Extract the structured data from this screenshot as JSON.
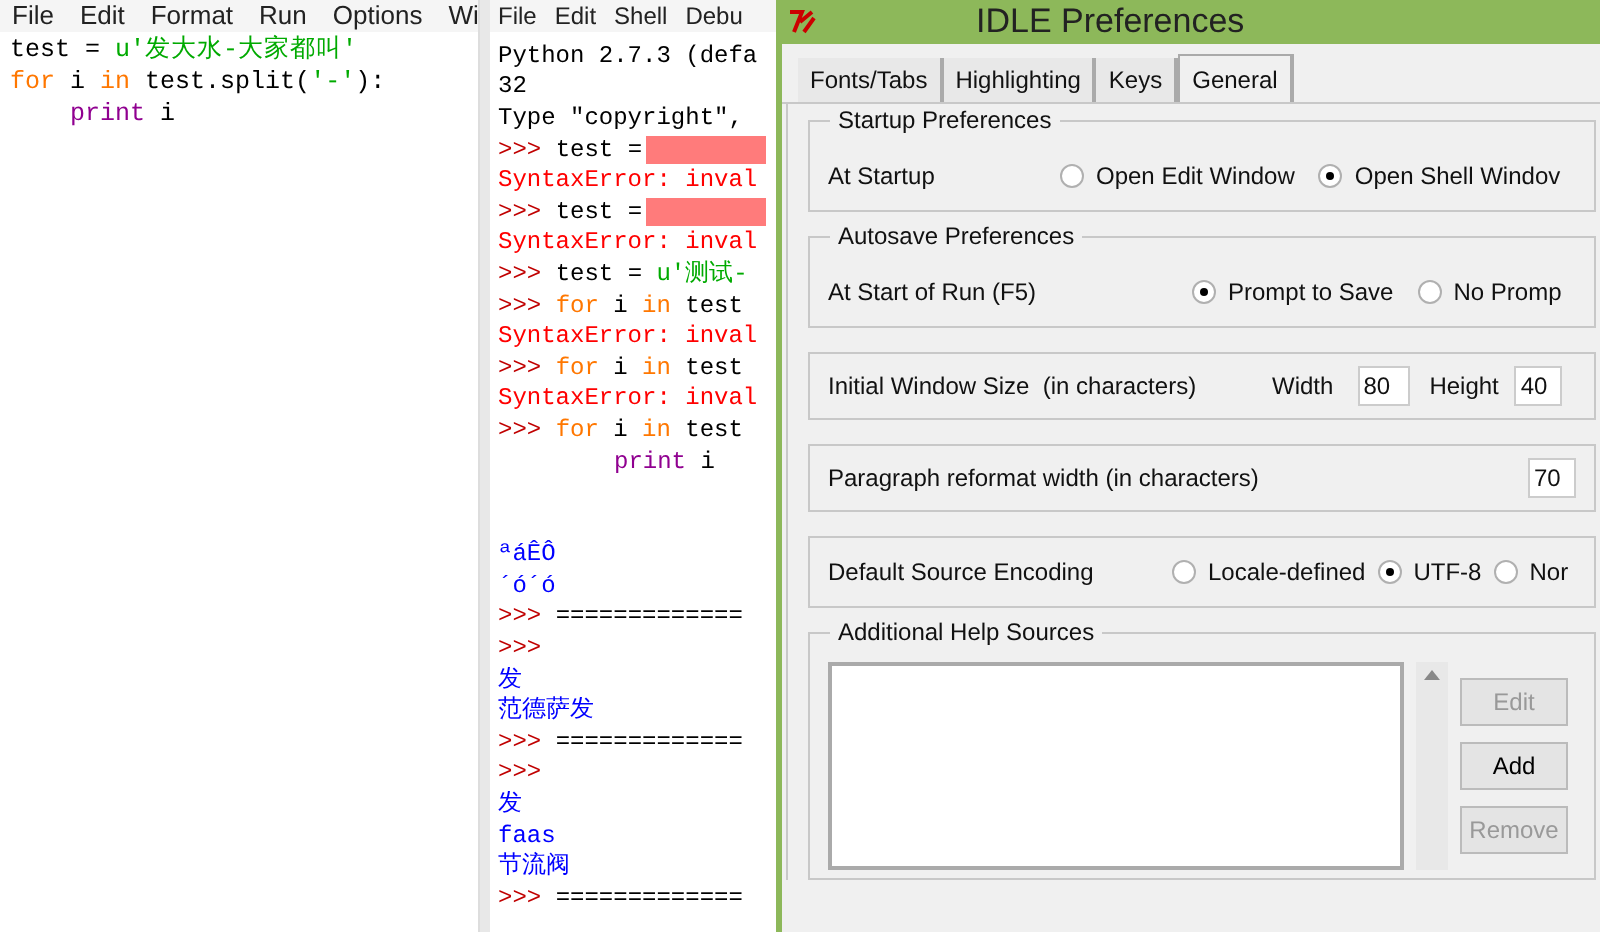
{
  "editor": {
    "menu": [
      "File",
      "Edit",
      "Format",
      "Run",
      "Options",
      "Wi"
    ],
    "lines": [
      {
        "segments": [
          {
            "text": "test = ",
            "kind": "plain"
          },
          {
            "text": "u'发大水-大家都叫'",
            "kind": "string"
          }
        ]
      },
      {
        "segments": [
          {
            "text": "for",
            "kind": "keyword"
          },
          {
            "text": " i ",
            "kind": "plain"
          },
          {
            "text": "in",
            "kind": "keyword"
          },
          {
            "text": " test.split(",
            "kind": "plain"
          },
          {
            "text": "'-'",
            "kind": "string"
          },
          {
            "text": "):",
            "kind": "plain"
          }
        ],
        "children": [
          {
            "segments": [
              {
                "text": "print",
                "kind": "builtin"
              },
              {
                "text": " i",
                "kind": "plain"
              }
            ]
          }
        ]
      }
    ]
  },
  "shell": {
    "menu": [
      "File",
      "Edit",
      "Shell",
      "Debu"
    ],
    "lines": [
      {
        "kind": "code",
        "segments": [
          {
            "text": "Python 2.7.3 (defa",
            "kind": "plain"
          }
        ]
      },
      {
        "kind": "code",
        "segments": [
          {
            "text": "32",
            "kind": "plain"
          }
        ]
      },
      {
        "kind": "code",
        "segments": [
          {
            "text": "Type \"copyright\",",
            "kind": "plain"
          }
        ]
      },
      {
        "kind": "code",
        "segments": [
          {
            "text": ">>> ",
            "kind": "prompt"
          },
          {
            "text": "test =",
            "kind": "plain"
          }
        ],
        "redacted": true
      },
      {
        "kind": "code",
        "segments": [
          {
            "text": "SyntaxError: inval",
            "kind": "error"
          }
        ]
      },
      {
        "kind": "code",
        "segments": [
          {
            "text": ">>> ",
            "kind": "prompt"
          },
          {
            "text": "test =",
            "kind": "plain"
          }
        ],
        "redacted": true
      },
      {
        "kind": "code",
        "segments": [
          {
            "text": "SyntaxError: inval",
            "kind": "error"
          }
        ]
      },
      {
        "kind": "code",
        "segments": [
          {
            "text": ">>> ",
            "kind": "prompt"
          },
          {
            "text": "test = ",
            "kind": "plain"
          },
          {
            "text": "u'测试-",
            "kind": "string"
          }
        ]
      },
      {
        "kind": "code",
        "segments": [
          {
            "text": ">>> ",
            "kind": "prompt"
          },
          {
            "text": "for",
            "kind": "keyword"
          },
          {
            "text": " i ",
            "kind": "plain"
          },
          {
            "text": "in",
            "kind": "keyword"
          },
          {
            "text": " test",
            "kind": "plain"
          }
        ]
      },
      {
        "kind": "code",
        "segments": [
          {
            "text": "SyntaxError: inval",
            "kind": "error"
          }
        ]
      },
      {
        "kind": "code",
        "segments": [
          {
            "text": ">>> ",
            "kind": "prompt"
          },
          {
            "text": "for",
            "kind": "keyword"
          },
          {
            "text": " i ",
            "kind": "plain"
          },
          {
            "text": "in",
            "kind": "keyword"
          },
          {
            "text": " test",
            "kind": "plain"
          }
        ]
      },
      {
        "kind": "code",
        "segments": [
          {
            "text": "SyntaxError: inval",
            "kind": "error"
          }
        ]
      },
      {
        "kind": "code",
        "segments": [
          {
            "text": ">>> ",
            "kind": "prompt"
          },
          {
            "text": "for",
            "kind": "keyword"
          },
          {
            "text": " i ",
            "kind": "plain"
          },
          {
            "text": "in",
            "kind": "keyword"
          },
          {
            "text": " test",
            "kind": "plain"
          }
        ],
        "children": [
          {
            "segments": [
              {
                "text": "print",
                "kind": "builtin"
              },
              {
                "text": " i",
                "kind": "plain"
              }
            ]
          }
        ]
      },
      {
        "kind": "blank"
      },
      {
        "kind": "blank"
      },
      {
        "kind": "code",
        "segments": [
          {
            "text": "ªáÊÔ",
            "kind": "output"
          }
        ]
      },
      {
        "kind": "code",
        "segments": [
          {
            "text": "´ó´ó",
            "kind": "output"
          }
        ]
      },
      {
        "kind": "code",
        "segments": [
          {
            "text": ">>> ",
            "kind": "prompt"
          },
          {
            "text": "=============",
            "kind": "plain"
          }
        ]
      },
      {
        "kind": "code",
        "segments": [
          {
            "text": ">>>",
            "kind": "prompt"
          }
        ]
      },
      {
        "kind": "code",
        "segments": [
          {
            "text": "发",
            "kind": "output"
          }
        ]
      },
      {
        "kind": "code",
        "segments": [
          {
            "text": "范德萨发",
            "kind": "output"
          }
        ]
      },
      {
        "kind": "code",
        "segments": [
          {
            "text": ">>> ",
            "kind": "prompt"
          },
          {
            "text": "=============",
            "kind": "plain"
          }
        ]
      },
      {
        "kind": "code",
        "segments": [
          {
            "text": ">>>",
            "kind": "prompt"
          }
        ]
      },
      {
        "kind": "code",
        "segments": [
          {
            "text": "发",
            "kind": "output"
          }
        ]
      },
      {
        "kind": "code",
        "segments": [
          {
            "text": "faas",
            "kind": "output"
          }
        ]
      },
      {
        "kind": "code",
        "segments": [
          {
            "text": "节流阀",
            "kind": "output"
          }
        ]
      },
      {
        "kind": "code",
        "segments": [
          {
            "text": ">>> ",
            "kind": "prompt"
          },
          {
            "text": "=============",
            "kind": "plain"
          }
        ]
      }
    ]
  },
  "preferences": {
    "window": {
      "title": "IDLE Preferences"
    },
    "tabs": [
      {
        "label": "Fonts/Tabs",
        "selected": false
      },
      {
        "label": "Highlighting",
        "selected": false
      },
      {
        "label": "Keys",
        "selected": false
      },
      {
        "label": "General",
        "selected": true
      }
    ],
    "startup": {
      "title": "Startup Preferences",
      "label": "At Startup",
      "options": [
        {
          "label": "Open Edit Window",
          "selected": false
        },
        {
          "label": "Open Shell Windov",
          "selected": true
        }
      ]
    },
    "autosave": {
      "title": "Autosave Preferences",
      "label": "At Start of Run (F5)",
      "options": [
        {
          "label": "Prompt to Save",
          "selected": true
        },
        {
          "label": "No Promp",
          "selected": false
        }
      ]
    },
    "window_size": {
      "label": "Initial Window Size  (in characters)",
      "width_label": "Width",
      "width_value": "80",
      "height_label": "Height",
      "height_value": "40"
    },
    "paragraph": {
      "label": "Paragraph reformat width (in characters)",
      "value": "70"
    },
    "encoding": {
      "label": "Default Source Encoding",
      "options": [
        {
          "label": "Locale-defined",
          "selected": false
        },
        {
          "label": "UTF-8",
          "selected": true
        },
        {
          "label": "Nor",
          "selected": false
        }
      ]
    },
    "help_sources": {
      "title": "Additional Help Sources",
      "buttons": [
        {
          "label": "Edit",
          "disabled": true
        },
        {
          "label": "Add",
          "disabled": false
        },
        {
          "label": "Remove",
          "disabled": true
        }
      ]
    }
  }
}
